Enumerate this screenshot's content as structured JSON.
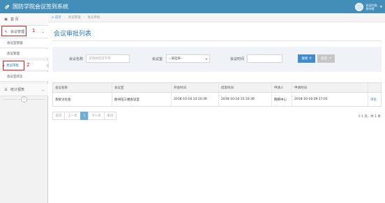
{
  "header": {
    "title": "国防学院会议签到系统",
    "user_line1": "欢迎光临,",
    "user_line2": "图书馆"
  },
  "breadcrumb": {
    "items": [
      "首页",
      "会议管理",
      "会议审批"
    ]
  },
  "sidebar": {
    "home": "首 页",
    "group1": "会议管理",
    "sub_items": [
      "会议室管理",
      "会议管理",
      "会议审批",
      "会议室状态"
    ],
    "group2": "统计报表"
  },
  "annotations": [
    "1",
    "2",
    "3"
  ],
  "page_title": "会议审批列表",
  "search": {
    "name_label": "会议名称",
    "name_placeholder": "支持拼音首字母",
    "room_label": "会议室",
    "room_value": "--请选择--",
    "time_label": "会议时间",
    "time_value": "",
    "search_btn": "搜索",
    "reset_btn": "重置"
  },
  "table": {
    "headers": [
      "会议名称",
      "会议室",
      "开会时间",
      "结束时间",
      "申请人",
      "申请时间",
      ""
    ],
    "rows": [
      [
        "系统讨论会",
        "图书馆三楼会议室",
        "2018-10-18 14:10:39",
        "2018-10-18 15:10:39",
        "网络中心",
        "2018-10-18 09:17:01",
        "审批"
      ]
    ]
  },
  "pager": {
    "first": "首页",
    "prev": "上一页",
    "current": "1",
    "next": "下一页",
    "last": "末页",
    "info": "1-1 页，共 1 条"
  },
  "colors": {
    "header_bg": "#438eb9",
    "accent": "#2679b5",
    "annotation": "#e02020"
  }
}
